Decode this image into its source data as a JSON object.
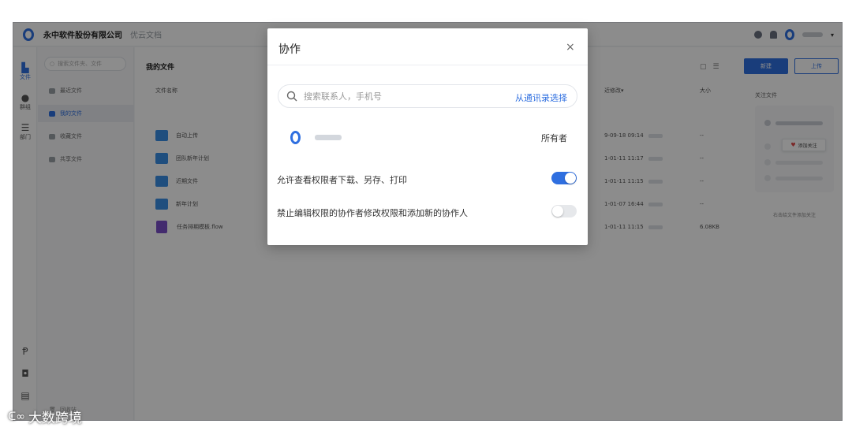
{
  "topbar": {
    "company": "永中软件股份有限公司",
    "product": "优云文档",
    "user_caret": "▾"
  },
  "rail": {
    "items": [
      {
        "label": "文件",
        "icon": "file-icon"
      },
      {
        "label": "群组",
        "icon": "group-icon"
      },
      {
        "label": "部门",
        "icon": "department-icon"
      }
    ],
    "bottom_icons": [
      "p-icon",
      "gift-icon",
      "doc-icon"
    ]
  },
  "sidebar": {
    "search_placeholder": "搜索文件夹、文件",
    "items": [
      {
        "label": "最近文件"
      },
      {
        "label": "我的文件"
      },
      {
        "label": "收藏文件"
      },
      {
        "label": "共享文件"
      }
    ],
    "trash": "回收站"
  },
  "main": {
    "title": "我的文件",
    "new_label": "新建",
    "upload_label": "上传",
    "columns": {
      "name": "文件名称",
      "modified": "近修改▾",
      "size": "大小"
    },
    "files": [
      {
        "name": "自动上传",
        "type": "folder",
        "modified": "9-09-18 09:14",
        "size": "--"
      },
      {
        "name": "团队新年计划",
        "type": "folder",
        "modified": "1-01-11 11:17",
        "size": "--"
      },
      {
        "name": "近期文件",
        "type": "folder",
        "modified": "1-01-11 11:15",
        "size": "--"
      },
      {
        "name": "新年计划",
        "type": "folder",
        "modified": "1-01-07 16:44",
        "size": "--"
      },
      {
        "name": "任务排期模板.flow",
        "type": "flow",
        "modified": "1-01-11 11:15",
        "size": "6.08KB"
      }
    ]
  },
  "focus": {
    "title": "关注文件",
    "add_label": "添加关注",
    "hint": "右击给文件添加关注"
  },
  "dialog": {
    "title": "协作",
    "close": "×",
    "search_placeholder": "搜索联系人，手机号",
    "contacts_link": "从通讯录选择",
    "owner_role": "所有者",
    "settings": [
      {
        "label": "允许查看权限者下载、另存、打印",
        "enabled": true
      },
      {
        "label": "禁止编辑权限的协作者修改权限和添加新的协作人",
        "enabled": false
      }
    ]
  },
  "watermark": {
    "text": "大数跨境"
  },
  "colors": {
    "accent": "#2f6fe0",
    "folder": "#3a8ee6",
    "flow": "#7b4fc9"
  }
}
